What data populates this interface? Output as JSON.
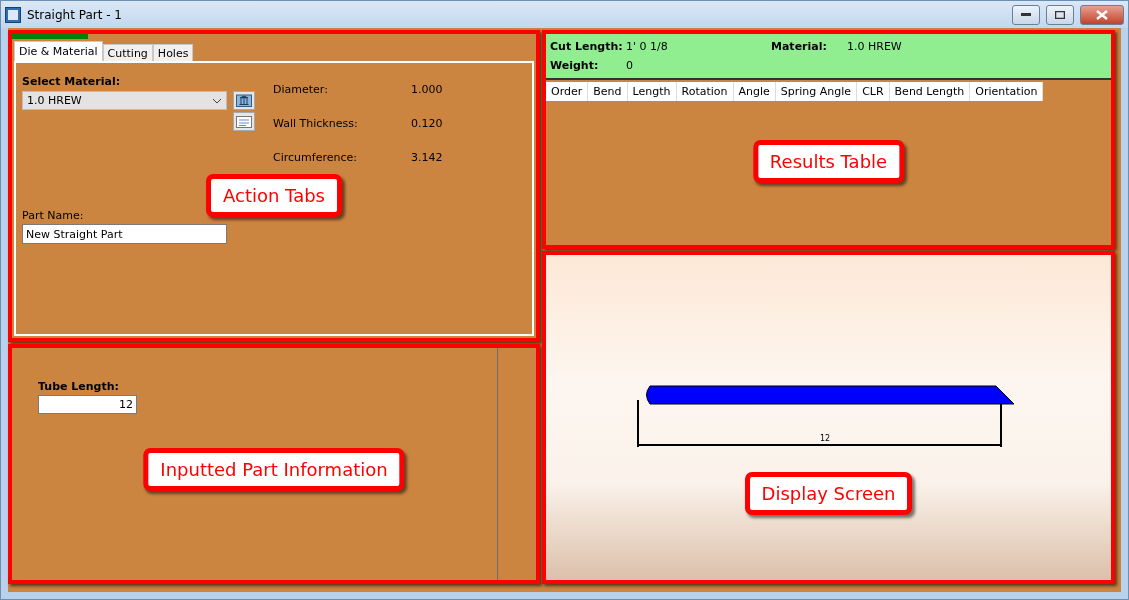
{
  "window": {
    "title": "Straight Part - 1"
  },
  "tabs": [
    {
      "label": "Die & Material",
      "selected": true
    },
    {
      "label": "Cutting",
      "selected": false
    },
    {
      "label": "Holes",
      "selected": false
    }
  ],
  "die_material": {
    "select_label": "Select Material:",
    "material": "1.0 HREW",
    "properties": [
      {
        "label": "Diameter:",
        "value": "1.000"
      },
      {
        "label": "Wall Thickness:",
        "value": "0.120"
      },
      {
        "label": "Circumference:",
        "value": "3.142"
      }
    ],
    "part_name_label": "Part Name:",
    "part_name": "New Straight Part"
  },
  "input_panel": {
    "tube_length_label": "Tube Length:",
    "tube_length": "12"
  },
  "summary": {
    "cut_length_label": "Cut Length:",
    "cut_length": "1' 0 1/8",
    "material_label": "Material:",
    "material": "1.0 HREW",
    "weight_label": "Weight:",
    "weight": "0"
  },
  "results_table": {
    "columns": [
      "Order",
      "Bend",
      "Length",
      "Rotation",
      "Angle",
      "Spring Angle",
      "CLR",
      "Bend Length",
      "Orientation"
    ]
  },
  "display": {
    "dimension": "12"
  },
  "callouts": [
    "Action Tabs",
    "Inputted Part Information",
    "Results Table",
    "Display Screen"
  ]
}
